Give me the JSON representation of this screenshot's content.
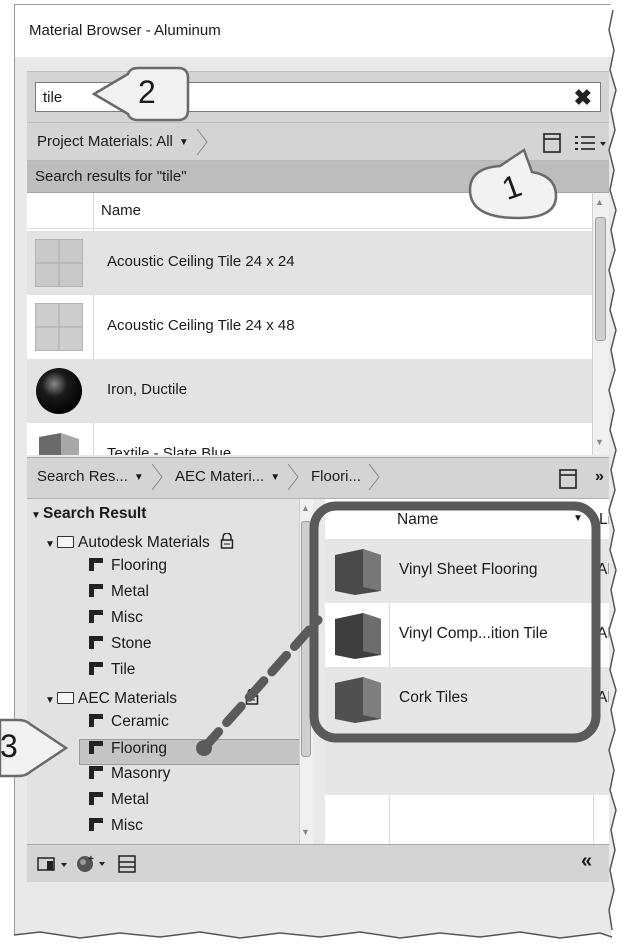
{
  "window": {
    "title": "Material Browser - Aluminum"
  },
  "search": {
    "value": "tile",
    "clear_glyph": "✖"
  },
  "upper_toolbar": {
    "filter_label": "Project Materials: All",
    "filter_arrow": "▼"
  },
  "results_header": "Search results for \"tile\"",
  "upper_list": {
    "column_name": "Name",
    "rows": [
      {
        "label": "Acoustic Ceiling Tile 24 x 24",
        "thumb": "tile-grid"
      },
      {
        "label": "Acoustic Ceiling Tile 24 x 48",
        "thumb": "tile-grid"
      },
      {
        "label": "Iron, Ductile",
        "thumb": "black-sphere"
      },
      {
        "label": "Textile - Slate Blue",
        "thumb": "slate-cube"
      }
    ]
  },
  "lower_toolbar": {
    "crumb1": "Search Res...",
    "crumb2": "AEC Materi...",
    "crumb3": "Floori...",
    "arrow": "▼",
    "more": "»"
  },
  "tree": {
    "root": "Search Result",
    "groups": [
      {
        "label": "Autodesk Materials",
        "children": [
          "Flooring",
          "Metal",
          "Misc",
          "Stone",
          "Tile"
        ]
      },
      {
        "label": "AEC Materials",
        "children": [
          "Ceramic",
          "Flooring",
          "Masonry",
          "Metal",
          "Misc"
        ]
      }
    ],
    "selected": "Flooring"
  },
  "grid": {
    "col_name": "Name",
    "col_sort_arrow": "▼",
    "col_lib": "Li",
    "rows": [
      {
        "name": "Vinyl Sheet Flooring",
        "lib": "AE"
      },
      {
        "name": "Vinyl Comp...ition Tile",
        "lib": "AE"
      },
      {
        "name": "Cork Tiles",
        "lib": "AE"
      }
    ]
  },
  "bottom_toolbar": {
    "collapse": "«"
  },
  "callouts": {
    "one": "1",
    "two": "2",
    "three": "3"
  },
  "colors": {
    "panel": "#d4d4d4",
    "highlight_box": "#5a5a5a",
    "callout_fill": "#f2f2f2"
  }
}
